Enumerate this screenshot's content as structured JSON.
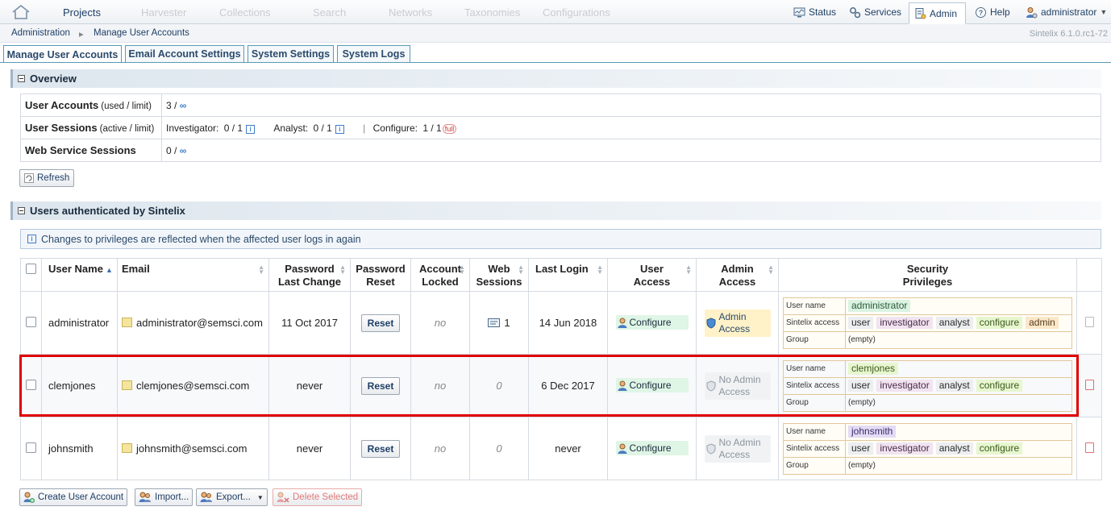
{
  "topnav": {
    "items": [
      "Projects",
      "Harvester",
      "Collections",
      "Search",
      "Networks",
      "Taxonomies",
      "Configurations"
    ],
    "right": {
      "status": "Status",
      "services": "Services",
      "admin": "Admin",
      "help": "Help",
      "user": "administrator"
    }
  },
  "breadcrumb": {
    "root": "Administration",
    "current": "Manage User Accounts"
  },
  "version": "Sintelix 6.1.0.rc1-72",
  "tabs": [
    "Manage User Accounts",
    "Email Account Settings",
    "System Settings",
    "System Logs"
  ],
  "overview": {
    "title": "Overview",
    "user_accounts_label": "User Accounts",
    "user_accounts_note": "(used / limit)",
    "user_accounts_value": "3 /",
    "user_sessions_label": "User Sessions",
    "user_sessions_note": "(active / limit)",
    "investigator_label": "Investigator:",
    "investigator_value": "0 / 1",
    "analyst_label": "Analyst:",
    "analyst_value": "0 / 1",
    "configure_label": "Configure:",
    "configure_value": "1 / 1",
    "full_badge": "full",
    "web_sessions_label": "Web Service Sessions",
    "web_sessions_value": "0 /",
    "infinity": "∞",
    "refresh": "Refresh"
  },
  "users_section": {
    "title": "Users authenticated by Sintelix",
    "info": "Changes to privileges are reflected when the affected user logs in again",
    "columns": [
      "User Name",
      "Email",
      "Password Last Change",
      "Password Reset",
      "Account Locked",
      "Web Sessions",
      "Last Login",
      "User Access",
      "Admin Access",
      "Security Privileges"
    ],
    "col_html": {
      "pwd_last": [
        "Password",
        "Last Change"
      ],
      "pwd_reset": [
        "Password",
        "Reset"
      ],
      "locked": [
        "Account",
        "Locked"
      ],
      "web": [
        "Web",
        "Sessions"
      ],
      "uaccess": [
        "User",
        "Access"
      ],
      "aaccess": [
        "Admin",
        "Access"
      ],
      "secpriv": [
        "Security",
        "Privileges"
      ]
    },
    "priv_keys": {
      "username": "User name",
      "sintelix": "Sintelix access",
      "group": "Group"
    },
    "rows": [
      {
        "username": "administrator",
        "email": "administrator@semsci.com",
        "pwd_last": "11 Oct 2017",
        "reset": "Reset",
        "locked": "no",
        "web": "1",
        "last_login": "14 Jun 2018",
        "user_access": "Configure",
        "admin_l1": "Admin",
        "admin_l2": "Access",
        "priv_user": "administrator",
        "priv_access": [
          "user",
          "investigator",
          "analyst",
          "configure",
          "admin"
        ],
        "group": "(empty)"
      },
      {
        "username": "clemjones",
        "email": "clemjones@semsci.com",
        "pwd_last": "never",
        "reset": "Reset",
        "locked": "no",
        "web": "0",
        "last_login": "6 Dec 2017",
        "user_access": "Configure",
        "admin_l1": "No Admin",
        "admin_l2": "Access",
        "priv_user": "clemjones",
        "priv_access": [
          "user",
          "investigator",
          "analyst",
          "configure"
        ],
        "group": "(empty)"
      },
      {
        "username": "johnsmith",
        "email": "johnsmith@semsci.com",
        "pwd_last": "never",
        "reset": "Reset",
        "locked": "no",
        "web": "0",
        "last_login": "never",
        "user_access": "Configure",
        "admin_l1": "No Admin",
        "admin_l2": "Access",
        "priv_user": "johnsmith",
        "priv_access": [
          "user",
          "investigator",
          "analyst",
          "configure"
        ],
        "group": "(empty)"
      }
    ]
  },
  "bottom_buttons": {
    "create": "Create User Account",
    "import": "Import...",
    "export": "Export...",
    "delete": "Delete Selected"
  }
}
